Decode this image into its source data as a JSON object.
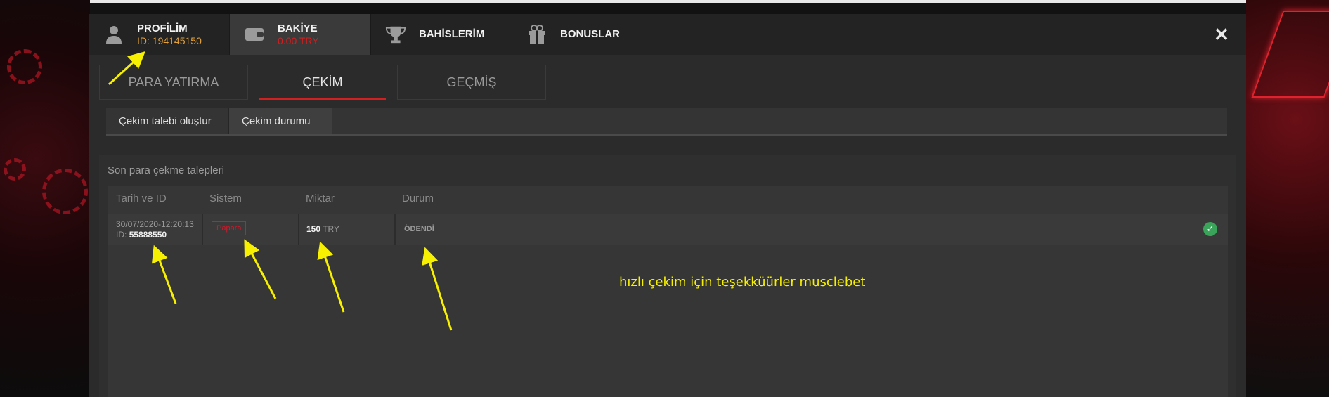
{
  "header": {
    "tabs": [
      {
        "label": "PROFİLİM",
        "sub": "ID: 194145150",
        "icon": "user-icon"
      },
      {
        "label": "BAKİYE",
        "sub": "0.00 TRY",
        "icon": "wallet-icon"
      },
      {
        "label": "BAHİSLERİM",
        "sub": "",
        "icon": "trophy-icon"
      },
      {
        "label": "BONUSLAR",
        "sub": "",
        "icon": "gift-icon"
      }
    ],
    "close": "✕"
  },
  "subtabs": [
    "PARA YATIRMA",
    "ÇEKİM",
    "GEÇMİŞ"
  ],
  "withdraw_tabs": [
    "Çekim talebi oluştur",
    "Çekim durumu"
  ],
  "panel": {
    "title": "Son para çekme talepleri",
    "columns": [
      "Tarih ve ID",
      "Sistem",
      "Miktar",
      "Durum"
    ],
    "row": {
      "date": "30/07/2020-12:20:13",
      "id_label": "ID:",
      "id": "55888550",
      "system": "Papara",
      "amount": "150",
      "currency": "TRY",
      "status": "ÖDENDİ",
      "check": "✓"
    }
  },
  "annotation": "hızlı çekim için teşekküürler musclebet",
  "colors": {
    "accent": "#d21f1f",
    "profile_id": "#e3a13a",
    "annotation": "#f7f000",
    "success": "#3aa55a"
  }
}
